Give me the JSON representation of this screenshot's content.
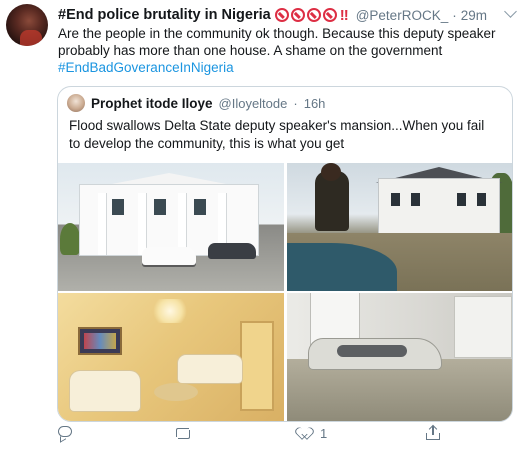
{
  "tweet": {
    "display_name": "#End police brutality in Nigeria",
    "bangs": "!!",
    "handle": "@PeterROCK_",
    "separator": "·",
    "time": "29m",
    "text": "Are the people in the community ok though. Because this deputy speaker probably has more than one house. A shame on the government",
    "hashtag": "#EndBadGoveranceInNigeria"
  },
  "quote": {
    "display_name": "Prophet itode Iloye",
    "handle": "@Iloyeltode",
    "separator": "·",
    "time": "16h",
    "text": "Flood swallows Delta State deputy speaker's mansion...When you fail to develop the community, this is what you get",
    "photos": [
      "white-mansion-photo",
      "flooded-mansion-canoe-photo",
      "luxury-living-room-photo",
      "submerged-car-photo"
    ]
  },
  "actions": {
    "reply_count": "",
    "retweet_count": "",
    "like_count": "1",
    "share_label": ""
  },
  "colors": {
    "accent": "#1b95e0",
    "muted": "#657786",
    "emoji_red": "#dd2e44",
    "border": "#ccd6dd"
  }
}
